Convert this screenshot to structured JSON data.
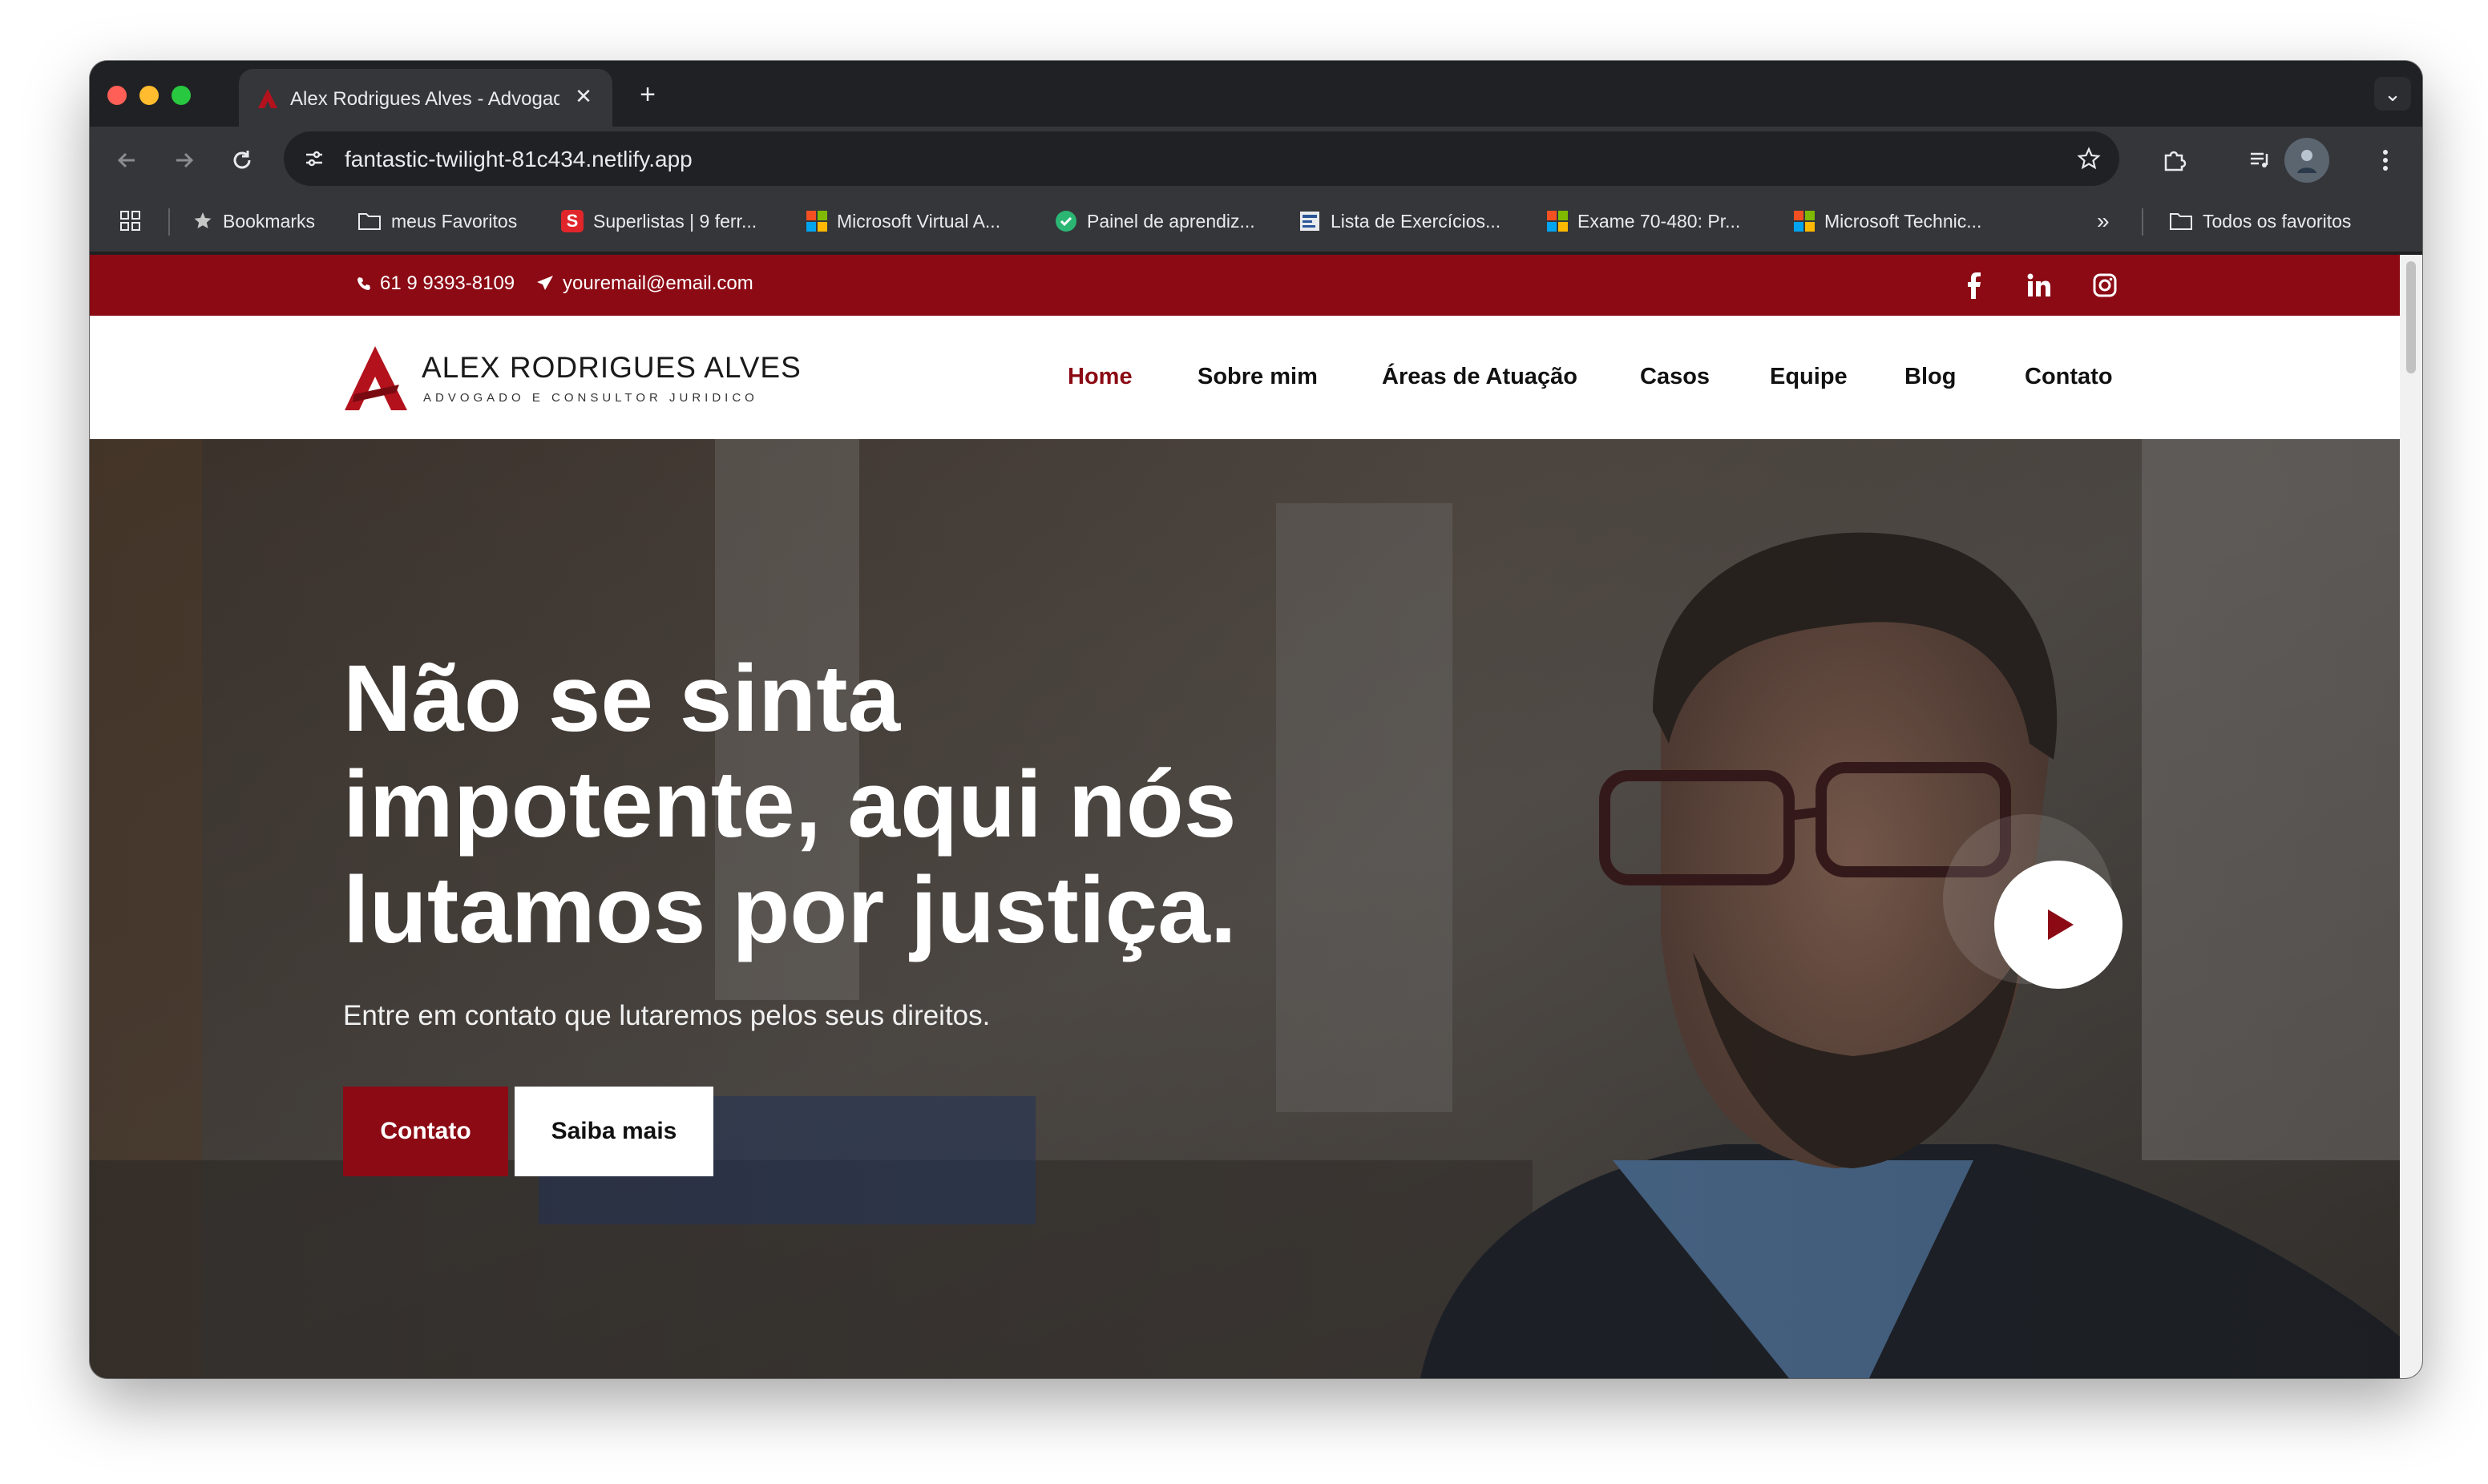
{
  "browser": {
    "tab_title": "Alex Rodrigues Alves - Advogado",
    "url": "fantastic-twilight-81c434.netlify.app",
    "icons": {
      "back": "back-arrow-icon",
      "forward": "forward-arrow-icon",
      "reload": "reload-icon",
      "site_info": "tune-icon",
      "star": "star-icon",
      "extensions": "puzzle-icon",
      "media": "media-queue-icon",
      "menu": "kebab-menu-icon"
    },
    "bookmarks": [
      {
        "label": "Bookmarks",
        "icon": "star-icon"
      },
      {
        "label": "meus Favoritos",
        "icon": "folder-icon"
      },
      {
        "label": "Superlistas | 9 ferr...",
        "icon": "superlistas-icon"
      },
      {
        "label": "Microsoft Virtual A...",
        "icon": "microsoft-icon"
      },
      {
        "label": "Painel de aprendiz...",
        "icon": "shield-check-icon"
      },
      {
        "label": "Lista de Exercícios...",
        "icon": "doc-icon"
      },
      {
        "label": "Exame 70-480: Pr...",
        "icon": "microsoft-icon"
      },
      {
        "label": "Microsoft Technic...",
        "icon": "microsoft-icon"
      }
    ],
    "all_bookmarks": "Todos os favoritos"
  },
  "site": {
    "topbar": {
      "phone": "61 9 9393-8109",
      "email": "youremail@email.com",
      "color": "#8b0a14"
    },
    "logo": {
      "name": "ALEX RODRIGUES ALVES",
      "subtitle": "ADVOGADO E CONSULTOR JURIDICO"
    },
    "nav": [
      {
        "label": "Home",
        "active": true
      },
      {
        "label": "Sobre mim"
      },
      {
        "label": "Áreas de Atuação"
      },
      {
        "label": "Casos"
      },
      {
        "label": "Equipe"
      },
      {
        "label": "Blog"
      },
      {
        "label": "Contato"
      }
    ],
    "hero": {
      "title_line1": "Não se sinta",
      "title_line2": "impotente, aqui nós",
      "title_line3": "lutamos por justiça.",
      "subtitle": "Entre em contato que lutaremos pelos seus direitos.",
      "primary_button": "Contato",
      "secondary_button": "Saiba mais"
    }
  }
}
